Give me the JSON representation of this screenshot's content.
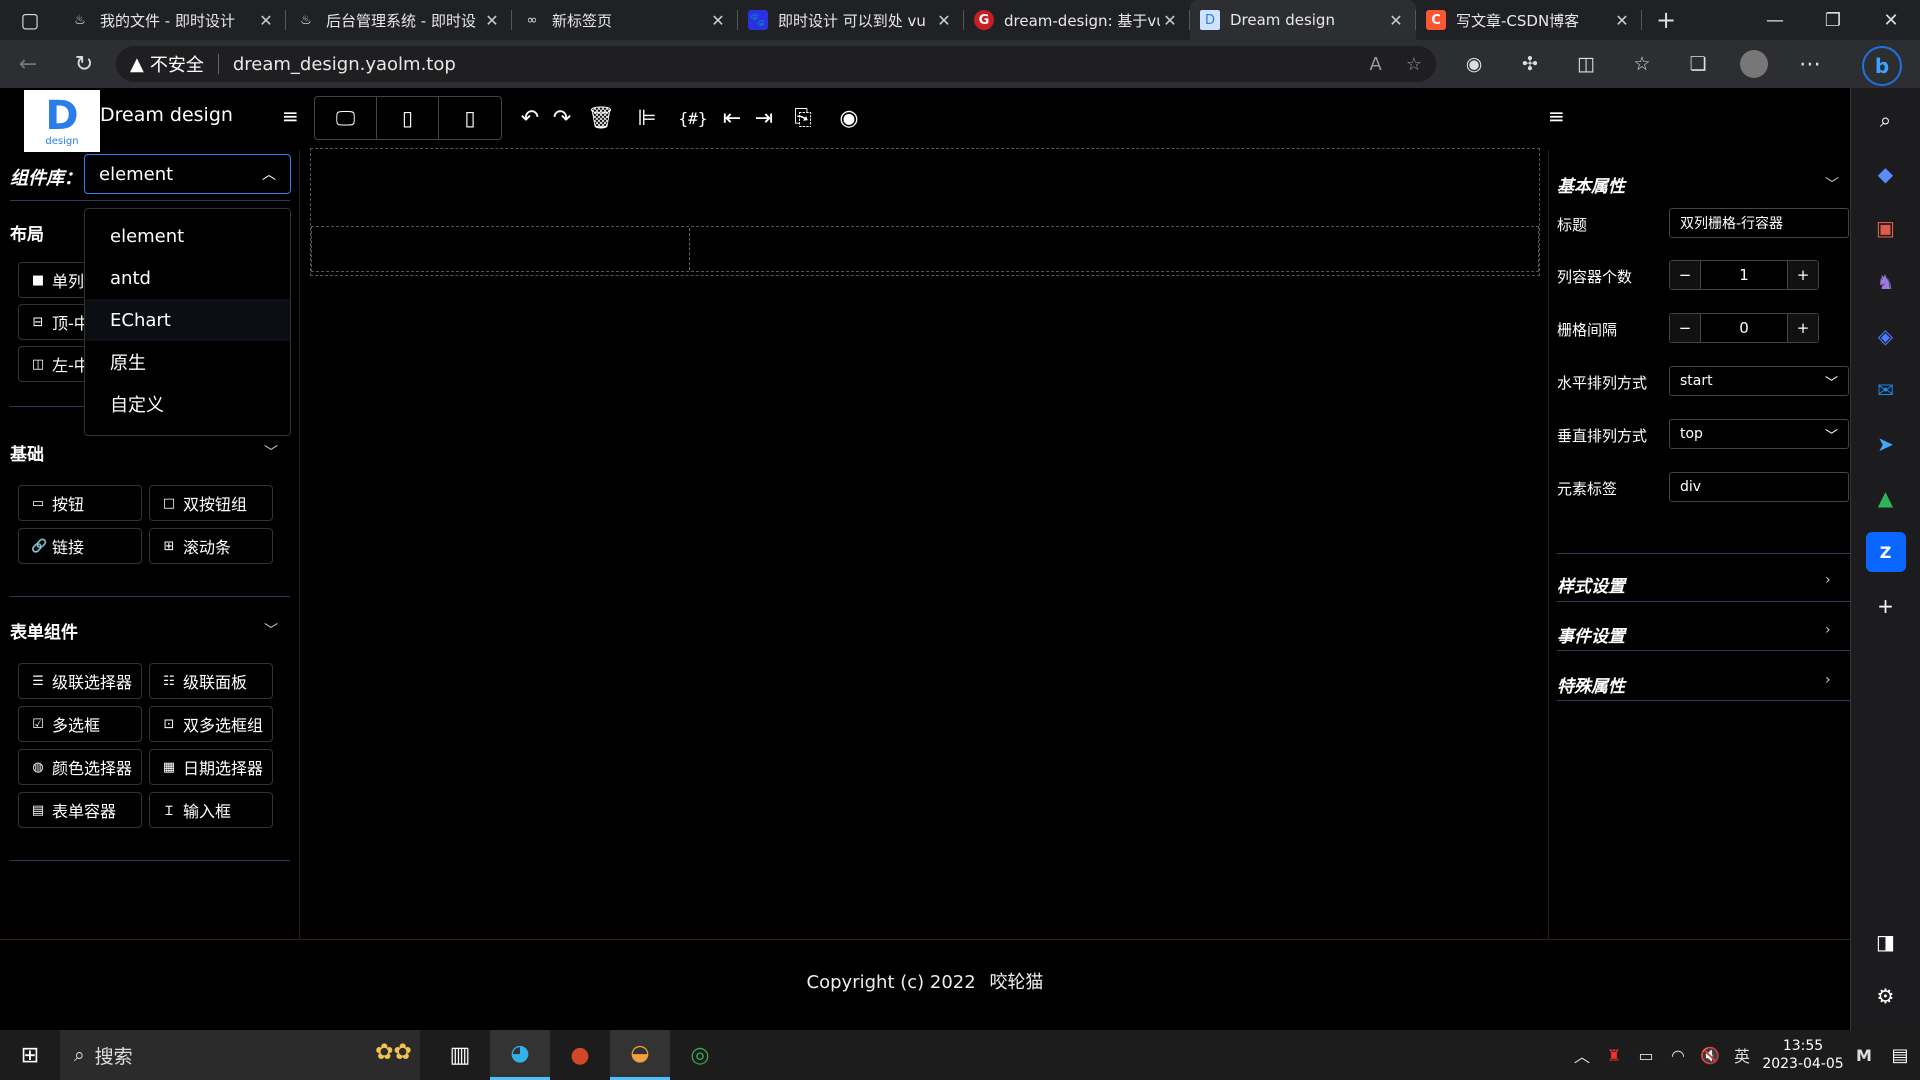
{
  "browser": {
    "tabs": [
      {
        "title": "我的文件 - 即时设计",
        "icon": "jishi-icon",
        "active": false
      },
      {
        "title": "后台管理系统 - 即时设",
        "icon": "jishi-icon",
        "active": false
      },
      {
        "title": "新标签页",
        "icon": "infinity-icon",
        "active": false
      },
      {
        "title": "即时设计 可以到处 vu",
        "icon": "baidu-icon",
        "active": false
      },
      {
        "title": "dream-design: 基于vu",
        "icon": "gitee-icon",
        "active": false
      },
      {
        "title": "Dream design",
        "icon": "page-icon",
        "active": true
      },
      {
        "title": "写文章-CSDN博客",
        "icon": "csdn-icon",
        "active": false
      }
    ],
    "security_label": "不安全",
    "url": "dream_design.yaolm.top"
  },
  "app": {
    "logo_letter": "D",
    "logo_subtext": "design",
    "title": "Dream design",
    "left_panel": {
      "library_label": "组件库：",
      "library_selected": "element",
      "library_options": [
        "element",
        "antd",
        "EChart",
        "原生",
        "自定义"
      ],
      "layout_section": {
        "title": "布局",
        "items": [
          {
            "label": "单列",
            "icon": "square-icon"
          },
          {
            "label": "顶-中",
            "icon": "layout-top-icon"
          },
          {
            "label": "左-中",
            "icon": "layout-left-icon"
          }
        ]
      },
      "basic_section": {
        "title": "基础",
        "items": [
          {
            "label": "按钮",
            "icon": "button-icon"
          },
          {
            "label": "双按钮组",
            "icon": "square-outline-icon"
          },
          {
            "label": "链接",
            "icon": "link-icon"
          },
          {
            "label": "滚动条",
            "icon": "scrollbar-icon"
          }
        ]
      },
      "form_section": {
        "title": "表单组件",
        "items": [
          {
            "label": "级联选择器",
            "icon": "cascader-icon"
          },
          {
            "label": "级联面板",
            "icon": "cascader-panel-icon"
          },
          {
            "label": "多选框",
            "icon": "checkbox-icon"
          },
          {
            "label": "双多选框组",
            "icon": "checkbox-group-icon"
          },
          {
            "label": "颜色选择器",
            "icon": "palette-icon"
          },
          {
            "label": "日期选择器",
            "icon": "calendar-icon"
          },
          {
            "label": "表单容器",
            "icon": "form-icon"
          },
          {
            "label": "输入框",
            "icon": "text-cursor-icon"
          }
        ]
      }
    },
    "right_panel": {
      "basic_props_title": "基本属性",
      "props": {
        "title_label": "标题",
        "title_value": "双列栅格-行容器",
        "col_count_label": "列容器个数",
        "col_count_value": "1",
        "gutter_label": "栅格间隔",
        "gutter_value": "0",
        "justify_label": "水平排列方式",
        "justify_value": "start",
        "align_label": "垂直排列方式",
        "align_value": "top",
        "tag_label": "元素标签",
        "tag_value": "div"
      },
      "style_title": "样式设置",
      "event_title": "事件设置",
      "special_title": "特殊属性"
    },
    "footer": {
      "copyright": "Copyright (c) 2022",
      "author": "咬轮猫"
    }
  },
  "taskbar": {
    "search_placeholder": "搜索",
    "ime": "英",
    "time": "13:55",
    "date": "2023-04-05"
  },
  "colors": {
    "accent": "#3b7ded",
    "section_line": "#2b3c5a",
    "background": "#000000"
  }
}
